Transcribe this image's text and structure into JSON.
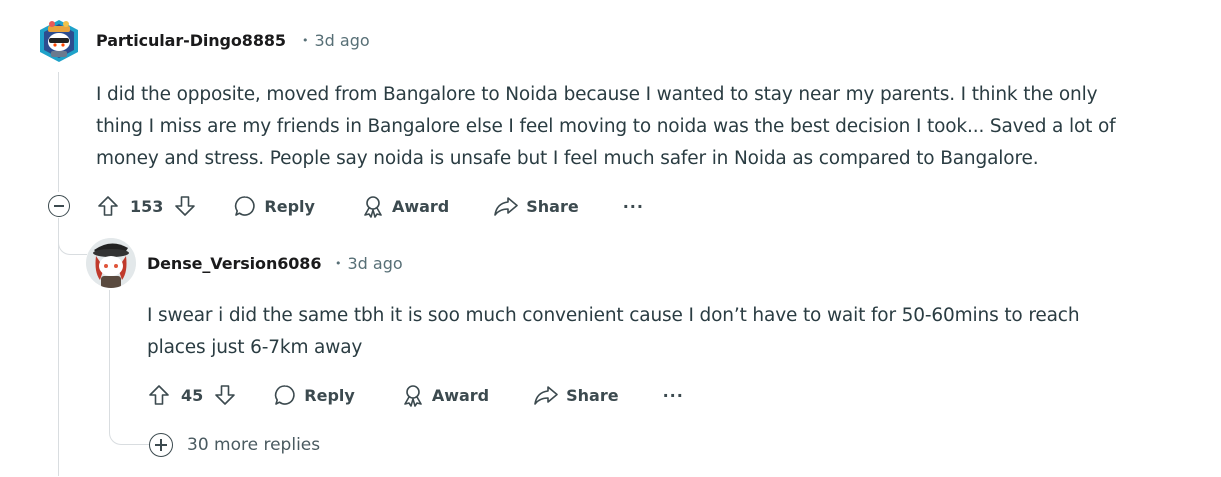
{
  "comments": [
    {
      "username": "Particular-Dingo8885",
      "age": "3d ago",
      "avatar_icon": "snoo-avatar-icon",
      "text_lines": [
        "I did the opposite, moved from Bangalore to Noida because I wanted to stay near my parents. I think the only",
        "thing I miss are my friends in Bangalore else I feel moving to noida was the best decision I took... Saved a lot of",
        "money and stress. People say noida is unsafe but I feel much safer in Noida as compared to Bangalore."
      ],
      "votes": "153",
      "actions": {
        "reply": "Reply",
        "award": "Award",
        "share": "Share",
        "more": "···"
      }
    },
    {
      "username": "Dense_Version6086",
      "age": "3d ago",
      "avatar_icon": "snoo-avatar-icon",
      "text_lines": [
        "I swear i did the same tbh it is soo much convenient cause I don’t have to wait for 50-60mins to reach",
        "places just 6-7km away"
      ],
      "votes": "45",
      "actions": {
        "reply": "Reply",
        "award": "Award",
        "share": "Share",
        "more": "···"
      }
    }
  ],
  "more_replies": "30 more replies",
  "colors": {
    "username": "#1a1a1b",
    "meta": "#576f76",
    "body": "#2a3c42",
    "action": "#3c4a4f",
    "thread_line": "#d9dde0"
  }
}
